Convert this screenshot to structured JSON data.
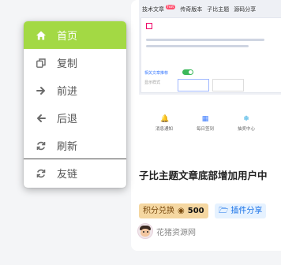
{
  "thumbnail": {
    "nav": [
      "技术文章",
      "传奇版本",
      "子比主题",
      "源码分享"
    ],
    "hot_badge": "hot",
    "toggle_label": "相关文章推荐",
    "sub_label": "显示样式"
  },
  "quick_links": [
    "消息通知",
    "每日签到",
    "抽奖中心"
  ],
  "card": {
    "title": "子比主题文章底部增加用户中",
    "points_label": "积分兑换",
    "points_value": "500",
    "category": "插件分享",
    "author": "花猪资源网"
  },
  "menu": {
    "items": [
      {
        "label": "首页",
        "icon": "home-icon"
      },
      {
        "label": "复制",
        "icon": "copy-icon"
      },
      {
        "label": "前进",
        "icon": "arrow-right-icon"
      },
      {
        "label": "后退",
        "icon": "arrow-left-icon"
      },
      {
        "label": "刷新",
        "icon": "refresh-icon"
      },
      {
        "label": "友链",
        "icon": "refresh-icon"
      }
    ]
  },
  "colors": {
    "menu_active": "#a3d944",
    "points_badge": "#f5d7a1",
    "category_badge": "#e6f2ff"
  }
}
